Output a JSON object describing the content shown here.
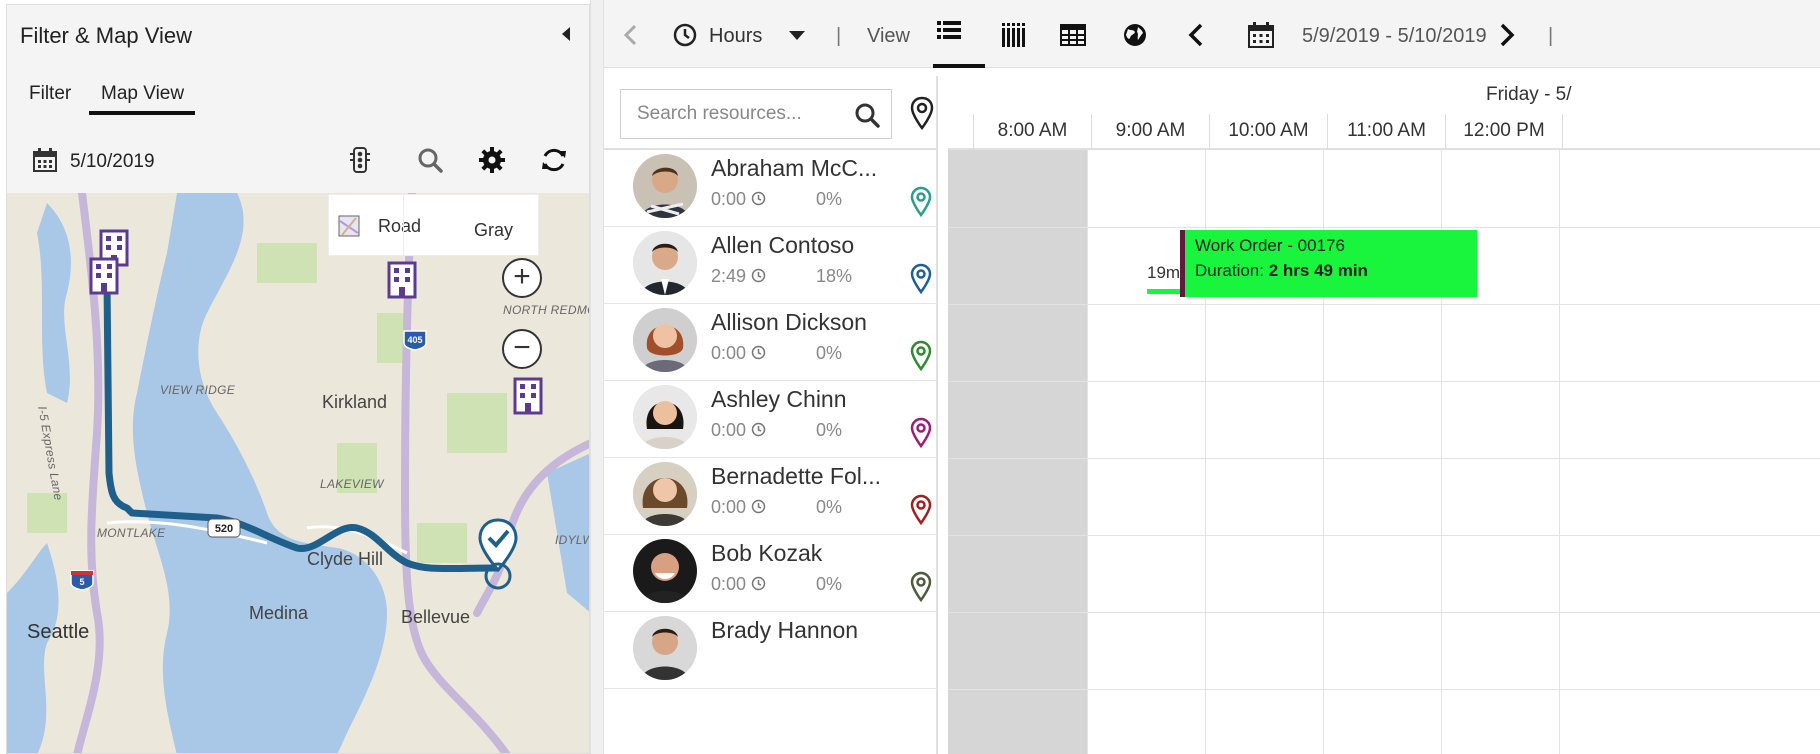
{
  "left_panel": {
    "title": "Filter & Map View",
    "tabs": [
      {
        "label": "Filter"
      },
      {
        "label": "Map View",
        "selected": true
      }
    ],
    "date": "5/10/2019",
    "tools": [
      "traffic-icon",
      "search-icon",
      "gear-icon",
      "refresh-icon"
    ],
    "map": {
      "style_options": {
        "road": "Road",
        "gray": "Gray"
      },
      "zoom_in": "+",
      "zoom_out": "−",
      "labels": {
        "seattle": "Seattle",
        "kirkland": "Kirkland",
        "clyde_hill": "Clyde Hill",
        "medina": "Medina",
        "bellevue": "Bellevue",
        "view_ridge": "VIEW RIDGE",
        "lakeview": "LAKEVIEW",
        "montlake": "MONTLAKE",
        "north_redmond": "NORTH REDMO",
        "idylw": "IDYLW",
        "express_lane": "I-5 Express Lane",
        "hwy_405": "405",
        "hwy_520": "520",
        "hwy_5": "5"
      },
      "colors": {
        "route": "#1f5f8b",
        "building": "#5c3b8f",
        "water": "#a9c7e6",
        "land": "#e9e4d8"
      }
    }
  },
  "toolbar": {
    "back_icon": "chevron-left-icon",
    "scale_label": "Hours",
    "separator": "|",
    "view_label": "View",
    "view_modes": [
      "list-view-icon",
      "vertical-view-icon",
      "table-view-icon",
      "map-view-icon"
    ],
    "date_range": "5/9/2019 - 5/10/2019"
  },
  "resources": {
    "search_placeholder": "Search resources...",
    "rows": [
      {
        "name": "Abraham McC...",
        "hours": "0:00",
        "util": "0%",
        "pin_color": "#2a9d8f"
      },
      {
        "name": "Allen Contoso",
        "hours": "2:49",
        "util": "18%",
        "pin_color": "#1d5f9b"
      },
      {
        "name": "Allison Dickson",
        "hours": "0:00",
        "util": "0%",
        "pin_color": "#2e8b2e"
      },
      {
        "name": "Ashley Chinn",
        "hours": "0:00",
        "util": "0%",
        "pin_color": "#9b1d76"
      },
      {
        "name": "Bernadette Fol...",
        "hours": "0:00",
        "util": "0%",
        "pin_color": "#a31f1f"
      },
      {
        "name": "Bob Kozak",
        "hours": "0:00",
        "util": "0%",
        "pin_color": "#4f5b3a"
      },
      {
        "name": "Brady Hannon",
        "hours": "",
        "util": "",
        "pin_color": "#777777"
      }
    ]
  },
  "timeline": {
    "day_label": "Friday - 5/",
    "hours": [
      "8:00 AM",
      "9:00 AM",
      "10:00 AM",
      "11:00 AM",
      "12:00 PM"
    ],
    "booking": {
      "title": "Work Order - 00176",
      "duration_label": "Duration:",
      "duration_value": "2 hrs 49 min",
      "travel": "19m",
      "color": "#19f53d"
    }
  }
}
